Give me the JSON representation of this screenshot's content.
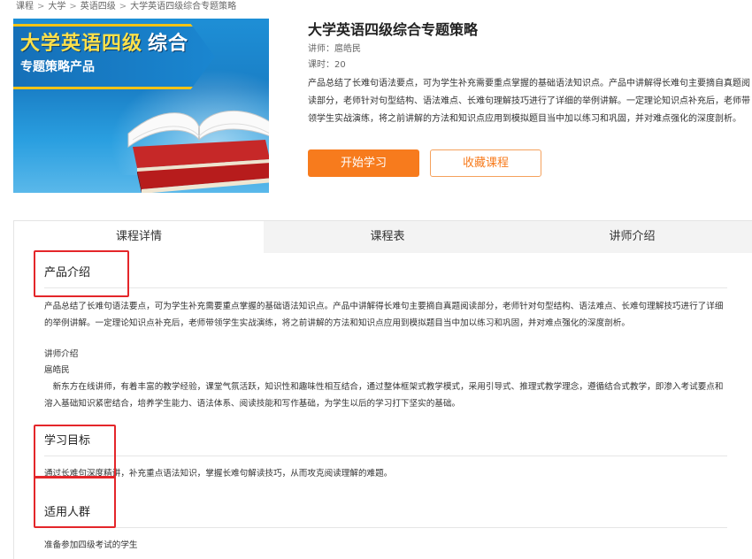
{
  "breadcrumb": [
    "课程",
    "大学",
    "英语四级",
    "大学英语四级综合专题策略"
  ],
  "breadcrumb_sep": ">",
  "cover": {
    "title_line1_a": "大学英语四级",
    "title_line1_b": "综合",
    "title_line2": "专题策略产品"
  },
  "course": {
    "title": "大学英语四级综合专题策略",
    "teacher": "讲师：扈皓民",
    "hours": "课时：20",
    "description": "产品总结了长难句语法要点，可为学生补充需要重点掌握的基础语法知识点。产品中讲解得长难句主要摘自真题阅读部分，老师针对句型结构、语法难点、长难句理解技巧进行了详细的举例讲解。一定理论知识点补充后，老师带领学生实战演练，将之前讲解的方法和知识点应用到模拟题目当中加以练习和巩固，并对难点强化的深度剖析。"
  },
  "buttons": {
    "start": "开始学习",
    "favorite": "收藏课程"
  },
  "tabs": [
    {
      "label": "课程详情",
      "active": true
    },
    {
      "label": "课程表",
      "active": false
    },
    {
      "label": "讲师介绍",
      "active": false
    }
  ],
  "details": {
    "product_intro_title": "产品介绍",
    "product_intro_text": "产品总结了长难句语法要点，可为学生补充需要重点掌握的基础语法知识点。产品中讲解得长难句主要摘自真题阅读部分，老师针对句型结构、语法难点、长难句理解技巧进行了详细的举例讲解。一定理论知识点补充后，老师带领学生实战演练，将之前讲解的方法和知识点应用到模拟题目当中加以练习和巩固，并对难点强化的深度剖析。",
    "teacher_intro_label": "讲师介绍",
    "teacher_name": "扈皓民",
    "teacher_bio": "　新东方在线讲师，有着丰富的教学经验，课堂气氛活跃，知识性和趣味性相互结合，通过整体框架式教学模式，采用引导式、推理式教学理念，遵循结合式教学，即渗入考试要点和溶入基础知识紧密结合，培养学生能力、语法体系、阅读技能和写作基础，为学生以后的学习打下坚实的基础。",
    "goal_title": "学习目标",
    "goal_text": "通过长难句深度精讲，补充重点语法知识，掌握长难句解读技巧，从而攻克阅读理解的难题。",
    "audience_title": "适用人群",
    "audience_text": "准备参加四级考试的学生"
  },
  "colors": {
    "accent": "#f77b1d",
    "highlight_box": "#e4262a",
    "cover_blue": "#1a86d0"
  }
}
